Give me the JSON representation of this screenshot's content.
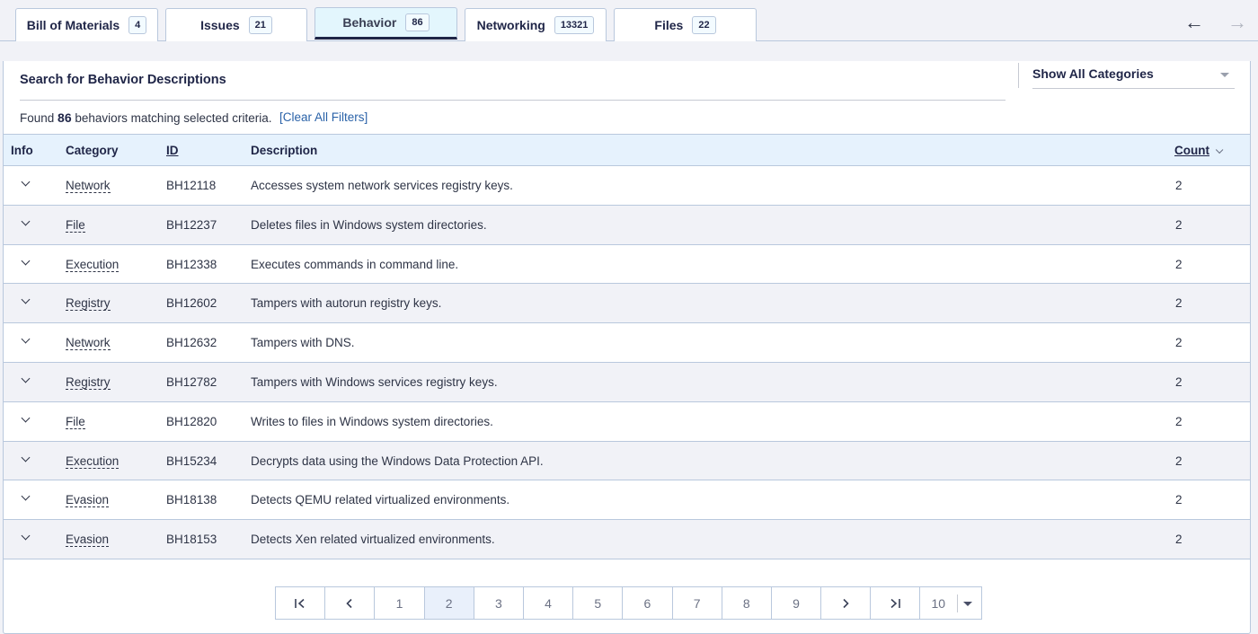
{
  "tabs": [
    {
      "label": "Bill of Materials",
      "count": "4",
      "active": false
    },
    {
      "label": "Issues",
      "count": "21",
      "active": false
    },
    {
      "label": "Behavior",
      "count": "86",
      "active": true
    },
    {
      "label": "Networking",
      "count": "13321",
      "active": false
    },
    {
      "label": "Files",
      "count": "22",
      "active": false
    }
  ],
  "nav": {
    "back_icon": "arrow-left-icon",
    "forward_icon": "arrow-right-icon",
    "back_glyph": "←",
    "forward_glyph": "→"
  },
  "search": {
    "title": "Search for Behavior Descriptions"
  },
  "category_filter": {
    "selected": "Show All Categories"
  },
  "results": {
    "prefix": "Found",
    "count": "86",
    "suffix": "behaviors matching selected criteria.",
    "clear_label": "[Clear All Filters]"
  },
  "table": {
    "headers": {
      "info": "Info",
      "category": "Category",
      "id": "ID",
      "description": "Description",
      "count": "Count"
    },
    "rows": [
      {
        "category": "Network",
        "id": "BH12118",
        "description": "Accesses system network services registry keys.",
        "count": "2"
      },
      {
        "category": "File",
        "id": "BH12237",
        "description": "Deletes files in Windows system directories.",
        "count": "2"
      },
      {
        "category": "Execution",
        "id": "BH12338",
        "description": "Executes commands in command line.",
        "count": "2"
      },
      {
        "category": "Registry",
        "id": "BH12602",
        "description": "Tampers with autorun registry keys.",
        "count": "2"
      },
      {
        "category": "Network",
        "id": "BH12632",
        "description": "Tampers with DNS.",
        "count": "2"
      },
      {
        "category": "Registry",
        "id": "BH12782",
        "description": "Tampers with Windows services registry keys.",
        "count": "2"
      },
      {
        "category": "File",
        "id": "BH12820",
        "description": "Writes to files in Windows system directories.",
        "count": "2"
      },
      {
        "category": "Execution",
        "id": "BH15234",
        "description": "Decrypts data using the Windows Data Protection API.",
        "count": "2"
      },
      {
        "category": "Evasion",
        "id": "BH18138",
        "description": "Detects QEMU related virtualized environments.",
        "count": "2"
      },
      {
        "category": "Evasion",
        "id": "BH18153",
        "description": "Detects Xen related virtualized environments.",
        "count": "2"
      }
    ]
  },
  "pagination": {
    "first_glyph": "|<",
    "prev_glyph": "<",
    "next_glyph": ">",
    "last_glyph": ">|",
    "pages": [
      "1",
      "2",
      "3",
      "4",
      "5",
      "6",
      "7",
      "8",
      "9"
    ],
    "current_page": "2",
    "page_size": "10"
  }
}
